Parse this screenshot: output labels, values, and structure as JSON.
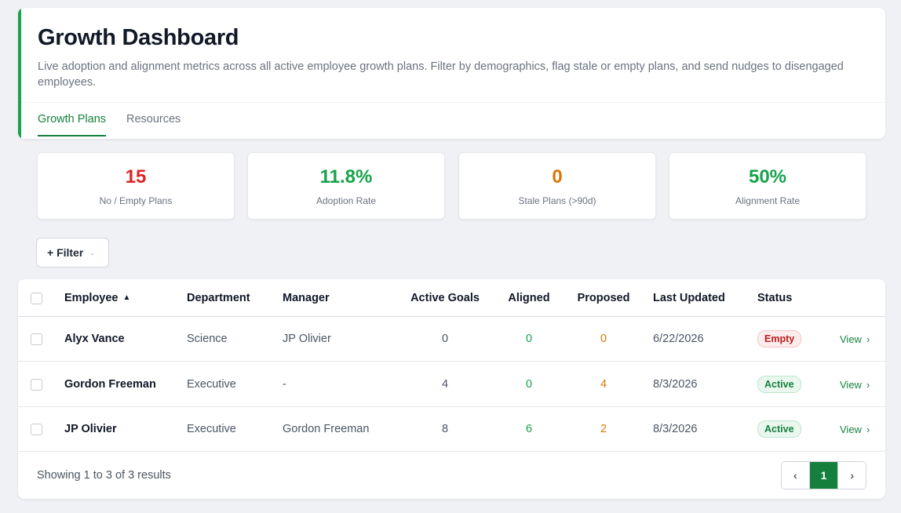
{
  "header": {
    "title": "Growth Dashboard",
    "description": "Live adoption and alignment metrics across all active employee growth plans. Filter by demographics, flag stale or empty plans, and send nudges to disengaged employees.",
    "tabs": [
      "Growth Plans",
      "Resources"
    ]
  },
  "stats": [
    {
      "value": "15",
      "label": "No / Empty Plans",
      "color": "#dc2626"
    },
    {
      "value": "11.8%",
      "label": "Adoption Rate",
      "color": "#16a34a"
    },
    {
      "value": "0",
      "label": "Stale Plans (>90d)",
      "color": "#d97706"
    },
    {
      "value": "50%",
      "label": "Alignment Rate",
      "color": "#16a34a"
    }
  ],
  "filter": {
    "label": "+ Filter"
  },
  "table": {
    "columns": {
      "employee": "Employee",
      "department": "Department",
      "manager": "Manager",
      "active_goals": "Active Goals",
      "aligned": "Aligned",
      "proposed": "Proposed",
      "last_updated": "Last Updated",
      "status": "Status"
    },
    "view_label": "View",
    "rows": [
      {
        "employee": "Alyx Vance",
        "department": "Science",
        "manager": "JP Olivier",
        "active_goals": "0",
        "aligned": "0",
        "proposed": "0",
        "last_updated": "6/22/2026",
        "status": "Empty"
      },
      {
        "employee": "Gordon Freeman",
        "department": "Executive",
        "manager": "-",
        "active_goals": "4",
        "aligned": "0",
        "proposed": "4",
        "last_updated": "8/3/2026",
        "status": "Active"
      },
      {
        "employee": "JP Olivier",
        "department": "Executive",
        "manager": "Gordon Freeman",
        "active_goals": "8",
        "aligned": "6",
        "proposed": "2",
        "last_updated": "8/3/2026",
        "status": "Active"
      }
    ]
  },
  "footer": {
    "showing": "Showing 1 to 3 of 3 results",
    "current_page": "1"
  },
  "colors": {
    "accent": "#16a34a",
    "brand_dark": "#15803d"
  }
}
